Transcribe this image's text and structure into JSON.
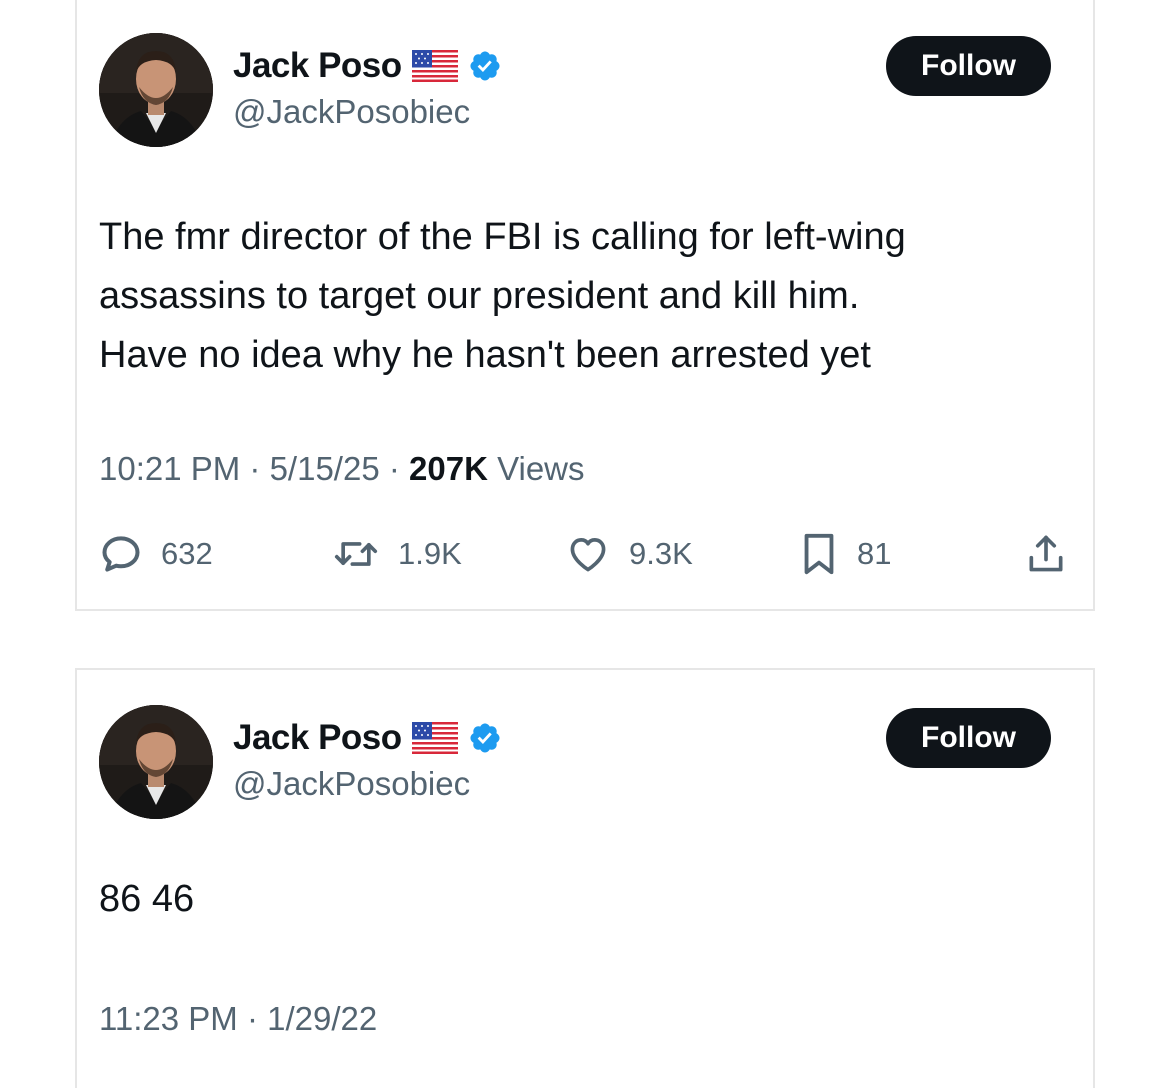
{
  "tweets": [
    {
      "author": {
        "display_name": "Jack Poso",
        "handle": "@JackPosobiec",
        "flag_icon": "us-flag-icon",
        "verified_icon": "verified-badge-icon"
      },
      "follow_label": "Follow",
      "text": "The fmr director of the FBI is calling for left-wing\nassassins to target our president and kill him.\nHave no idea why he hasn't been arrested yet",
      "time": "10:21 PM",
      "separator": " · ",
      "date": "5/15/25",
      "views_count": "207K",
      "views_label": " Views",
      "stats": {
        "replies": "632",
        "retweets": "1.9K",
        "likes": "9.3K",
        "bookmarks": "81"
      }
    },
    {
      "author": {
        "display_name": "Jack Poso",
        "handle": "@JackPosobiec",
        "flag_icon": "us-flag-icon",
        "verified_icon": "verified-badge-icon"
      },
      "follow_label": "Follow",
      "text": "86 46",
      "time": "11:23 PM",
      "separator": " · ",
      "date": "1/29/22"
    }
  ],
  "colors": {
    "text_primary": "#0f1419",
    "text_secondary": "#536471",
    "verified_blue": "#1d9bf0",
    "follow_bg": "#0f1419",
    "border": "#e6e6e6"
  }
}
